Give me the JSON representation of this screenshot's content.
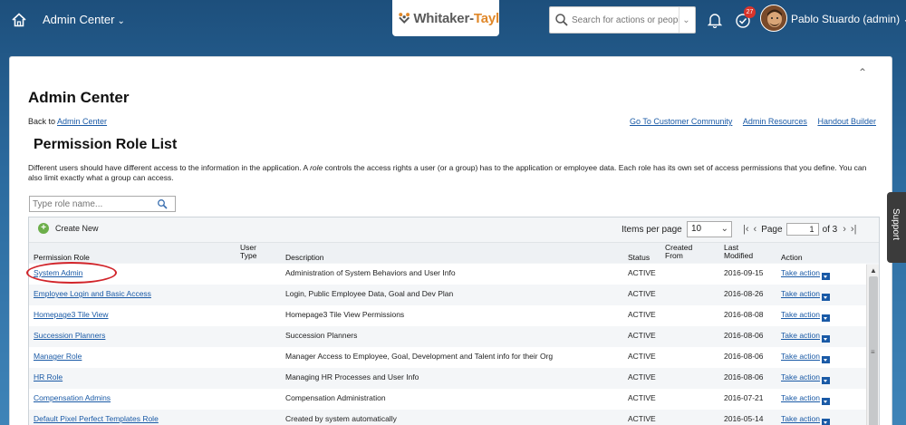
{
  "header": {
    "menu_label": "Admin Center",
    "brand_w": "Whitaker-",
    "brand_t": "Tayl",
    "search_placeholder": "Search for actions or people",
    "notifications_badge": "27",
    "user_name": "Pablo Stuardo (admin)"
  },
  "page": {
    "title": "Admin Center",
    "back_prefix": "Back to",
    "back_link": "Admin Center",
    "links": [
      "Go To Customer Community",
      "Admin Resources",
      "Handout Builder"
    ],
    "section_title": "Permission Role List",
    "description_1": "Different users should have different access to the information in the application. A ",
    "description_role": "role",
    "description_2": " controls the access rights a user (or a group) has to the application or employee data. Each role has its own set of access permissions that you define. You can also limit exactly what a group can access.",
    "role_search_placeholder": "Type role name..."
  },
  "table": {
    "create_label": "Create New",
    "items_per_page_label": "Items per page",
    "items_per_page_value": "10",
    "page_label": "Page",
    "page_value": "1",
    "page_of": "of 3",
    "columns": {
      "role": "Permission Role",
      "user_type": "User Type",
      "description": "Description",
      "status": "Status",
      "created_from": "Created From",
      "last_modified": "Last Modified",
      "action": "Action"
    },
    "rows": [
      {
        "role": "System Admin",
        "description": "Administration of System Behaviors and User Info",
        "status": "ACTIVE",
        "modified": "2016-09-15",
        "action": "Take action"
      },
      {
        "role": "Employee Login and Basic Access",
        "description": "Login, Public Employee Data, Goal and Dev Plan",
        "status": "ACTIVE",
        "modified": "2016-08-26",
        "action": "Take action"
      },
      {
        "role": "Homepage3 Tile View",
        "description": "Homepage3 Tile View Permissions",
        "status": "ACTIVE",
        "modified": "2016-08-08",
        "action": "Take action"
      },
      {
        "role": "Succession Planners",
        "description": "Succession Planners",
        "status": "ACTIVE",
        "modified": "2016-08-06",
        "action": "Take action"
      },
      {
        "role": "Manager Role",
        "description": "Manager Access to Employee, Goal, Development and Talent info for their Org",
        "status": "ACTIVE",
        "modified": "2016-08-06",
        "action": "Take action"
      },
      {
        "role": "HR Role",
        "description": "Managing HR Processes and User Info",
        "status": "ACTIVE",
        "modified": "2016-08-06",
        "action": "Take action"
      },
      {
        "role": "Compensation Admins",
        "description": "Compensation Administration",
        "status": "ACTIVE",
        "modified": "2016-07-21",
        "action": "Take action"
      },
      {
        "role": "Default Pixel Perfect Templates Role",
        "description": "Created by system automatically",
        "status": "ACTIVE",
        "modified": "2016-05-14",
        "action": "Take action"
      }
    ]
  },
  "support_label": "Support",
  "colors": {
    "accent_link": "#1a5aa6",
    "highlight": "#d1242a",
    "create_green": "#6cae4a"
  }
}
